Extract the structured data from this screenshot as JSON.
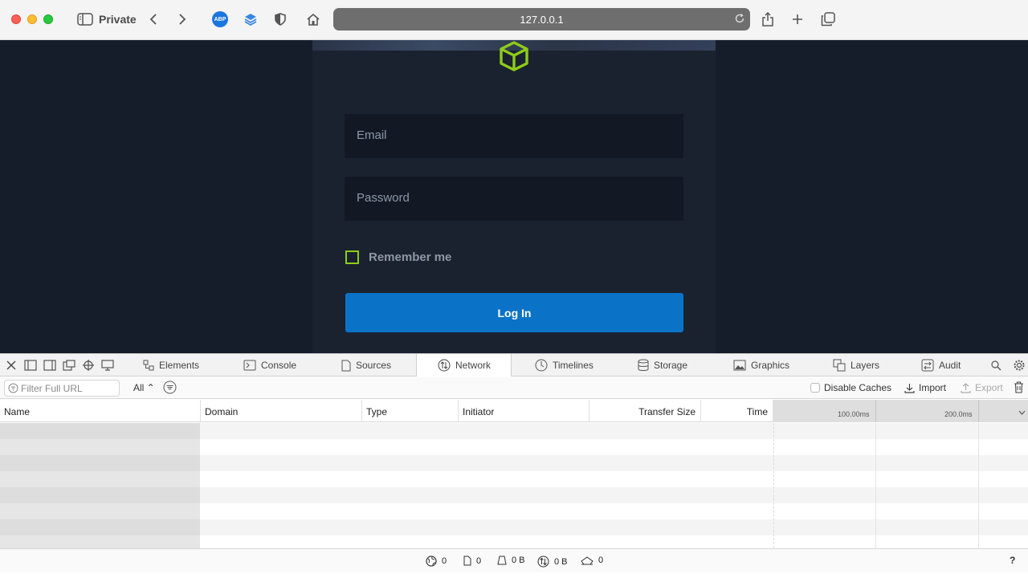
{
  "browser": {
    "private_label": "Private",
    "abp_label": "ABP",
    "url": "127.0.0.1"
  },
  "login": {
    "email_placeholder": "Email",
    "password_placeholder": "Password",
    "remember_label": "Remember me",
    "remember_checked": false,
    "login_button": "Log In",
    "accent_color": "#8ecb1a",
    "button_color": "#0a73c8"
  },
  "devtools": {
    "tabs": [
      {
        "label": "Elements",
        "icon": "elements-icon"
      },
      {
        "label": "Console",
        "icon": "console-icon"
      },
      {
        "label": "Sources",
        "icon": "sources-icon"
      },
      {
        "label": "Network",
        "icon": "network-icon",
        "active": true
      },
      {
        "label": "Timelines",
        "icon": "timelines-icon"
      },
      {
        "label": "Storage",
        "icon": "storage-icon"
      },
      {
        "label": "Graphics",
        "icon": "graphics-icon"
      },
      {
        "label": "Layers",
        "icon": "layers-icon"
      },
      {
        "label": "Audit",
        "icon": "audit-icon"
      }
    ],
    "filter_placeholder": "Filter Full URL",
    "type_filter": "All",
    "disable_caches": "Disable Caches",
    "disable_caches_checked": false,
    "import_label": "Import",
    "export_label": "Export",
    "columns": [
      "Name",
      "Domain",
      "Type",
      "Initiator",
      "Transfer Size",
      "Time"
    ],
    "timeline_ticks": [
      "100.00ms",
      "200.0ms"
    ],
    "status": {
      "requests": "0",
      "resources": "0",
      "transferred": "0 B",
      "size": "0 B",
      "load": "0"
    },
    "help": "?"
  }
}
